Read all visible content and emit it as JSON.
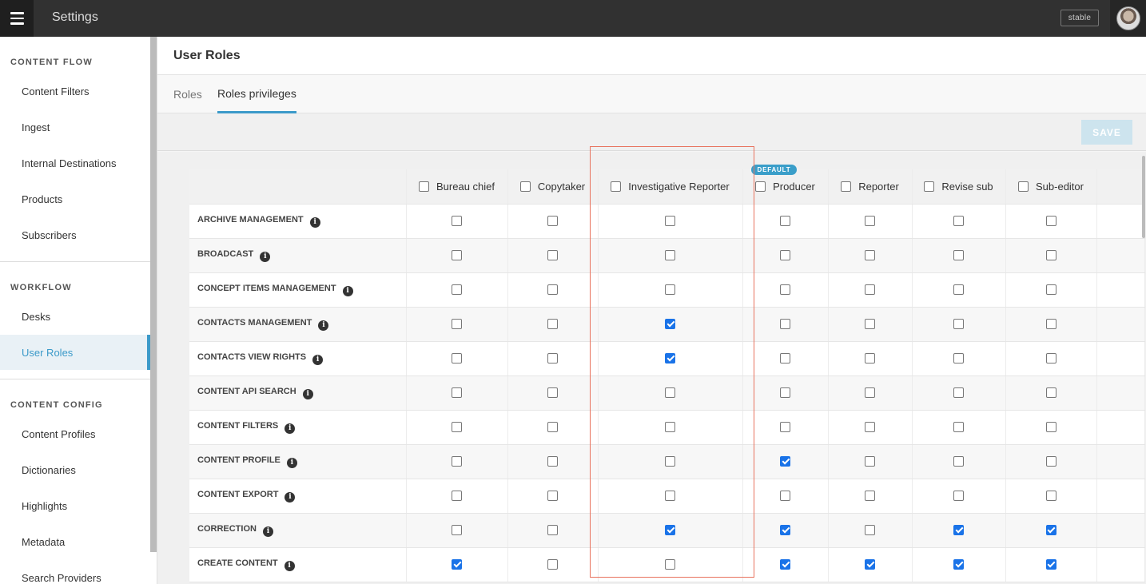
{
  "topbar": {
    "title": "Settings",
    "env_badge": "stable",
    "menu_icon": "hamburger-icon"
  },
  "sidebar": {
    "sections": [
      {
        "heading": "CONTENT FLOW",
        "items": [
          "Content Filters",
          "Ingest",
          "Internal Destinations",
          "Products",
          "Subscribers"
        ]
      },
      {
        "heading": "WORKFLOW",
        "items": [
          "Desks",
          "User Roles"
        ]
      },
      {
        "heading": "CONTENT CONFIG",
        "items": [
          "Content Profiles",
          "Dictionaries",
          "Highlights",
          "Metadata",
          "Search Providers"
        ]
      }
    ],
    "active": "User Roles"
  },
  "page": {
    "title": "User Roles"
  },
  "tabs": [
    {
      "label": "Roles"
    },
    {
      "label": "Roles privileges"
    }
  ],
  "active_tab": "Roles privileges",
  "toolbar": {
    "save_label": "SAVE"
  },
  "roles": [
    {
      "name": "Bureau chief",
      "default": false
    },
    {
      "name": "Copytaker",
      "default": false
    },
    {
      "name": "Investigative Reporter",
      "default": false
    },
    {
      "name": "Producer",
      "default": true
    },
    {
      "name": "Reporter",
      "default": false
    },
    {
      "name": "Revise sub",
      "default": false
    },
    {
      "name": "Sub-editor",
      "default": false
    }
  ],
  "default_badge": "DEFAULT",
  "privileges": [
    {
      "name": "ARCHIVE MANAGEMENT",
      "values": [
        false,
        false,
        false,
        false,
        false,
        false,
        false
      ]
    },
    {
      "name": "BROADCAST",
      "values": [
        false,
        false,
        false,
        false,
        false,
        false,
        false
      ]
    },
    {
      "name": "CONCEPT ITEMS MANAGEMENT",
      "values": [
        false,
        false,
        false,
        false,
        false,
        false,
        false
      ]
    },
    {
      "name": "CONTACTS MANAGEMENT",
      "values": [
        false,
        false,
        true,
        false,
        false,
        false,
        false
      ]
    },
    {
      "name": "CONTACTS VIEW RIGHTS",
      "values": [
        false,
        false,
        true,
        false,
        false,
        false,
        false
      ]
    },
    {
      "name": "CONTENT API SEARCH",
      "values": [
        false,
        false,
        false,
        false,
        false,
        false,
        false
      ]
    },
    {
      "name": "CONTENT FILTERS",
      "values": [
        false,
        false,
        false,
        false,
        false,
        false,
        false
      ]
    },
    {
      "name": "CONTENT PROFILE",
      "values": [
        false,
        false,
        false,
        true,
        false,
        false,
        false
      ]
    },
    {
      "name": "CONTENT EXPORT",
      "values": [
        false,
        false,
        false,
        false,
        false,
        false,
        false
      ]
    },
    {
      "name": "CORRECTION",
      "values": [
        false,
        false,
        true,
        true,
        false,
        true,
        true
      ]
    },
    {
      "name": "CREATE CONTENT",
      "values": [
        true,
        false,
        false,
        true,
        true,
        true,
        true
      ]
    }
  ]
}
